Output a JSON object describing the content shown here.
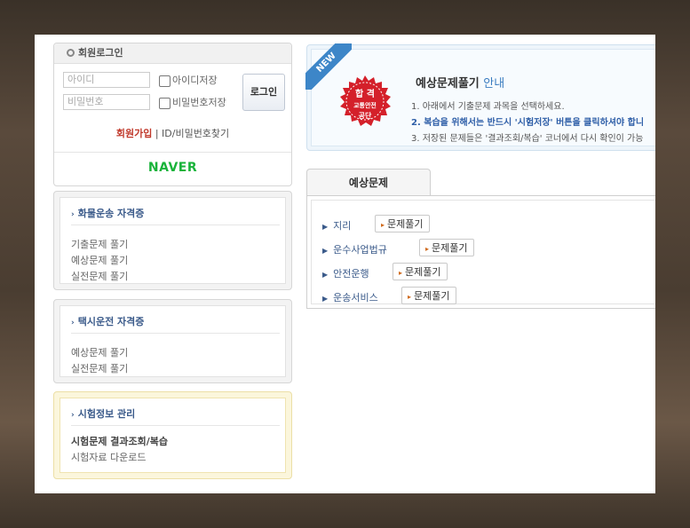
{
  "login": {
    "title": "회원로그인",
    "id_placeholder": "아이디",
    "pw_placeholder": "비밀번호",
    "save_id": "아이디저장",
    "save_pw": "비밀번호저장",
    "login_button": "로그인",
    "join": "회원가입",
    "separator": "|",
    "find": "ID/비밀번호찾기",
    "naver": "NAVER"
  },
  "cargo": {
    "title": "화물운송 자격증",
    "items": [
      "기출문제 풀기",
      "예상문제 풀기",
      "실전문제 풀기"
    ]
  },
  "taxi": {
    "title": "택시운전 자격증",
    "items": [
      "예상문제 풀기",
      "실전문제 풀기"
    ]
  },
  "exam_info": {
    "title": "시험정보 관리",
    "items": [
      "시험문제 결과조회/복습",
      "시험자료 다운로드"
    ]
  },
  "banner": {
    "ribbon": "NEW",
    "seal_line1": "합 격",
    "seal_line2": "교통안전",
    "seal_line3": "공단",
    "title": "예상문제풀기",
    "title_highlight": "안내",
    "line1": "1. 아래에서 기출문제 과목을 선택하세요.",
    "line2": "2. 복습을 위해서는 반드시 '시험저장' 버튼을 클릭하셔야 합니",
    "line3": "3. 저장된 문제들은 '결과조회/복습' 코너에서 다시 확인이 가능"
  },
  "tab": {
    "label": "예상문제"
  },
  "subjects": [
    {
      "name": "지리",
      "button": "문제풀기"
    },
    {
      "name": "운수사업법규",
      "button": "문제풀기"
    },
    {
      "name": "안전운행",
      "button": "문제풀기"
    },
    {
      "name": "운송서비스",
      "button": "문제풀기"
    }
  ],
  "colors": {
    "section_title": "#3a5a8a",
    "join": "#c0392b",
    "naver": "#19b33a",
    "ribbon": "#3d86c8",
    "seal": "#d4202a"
  }
}
